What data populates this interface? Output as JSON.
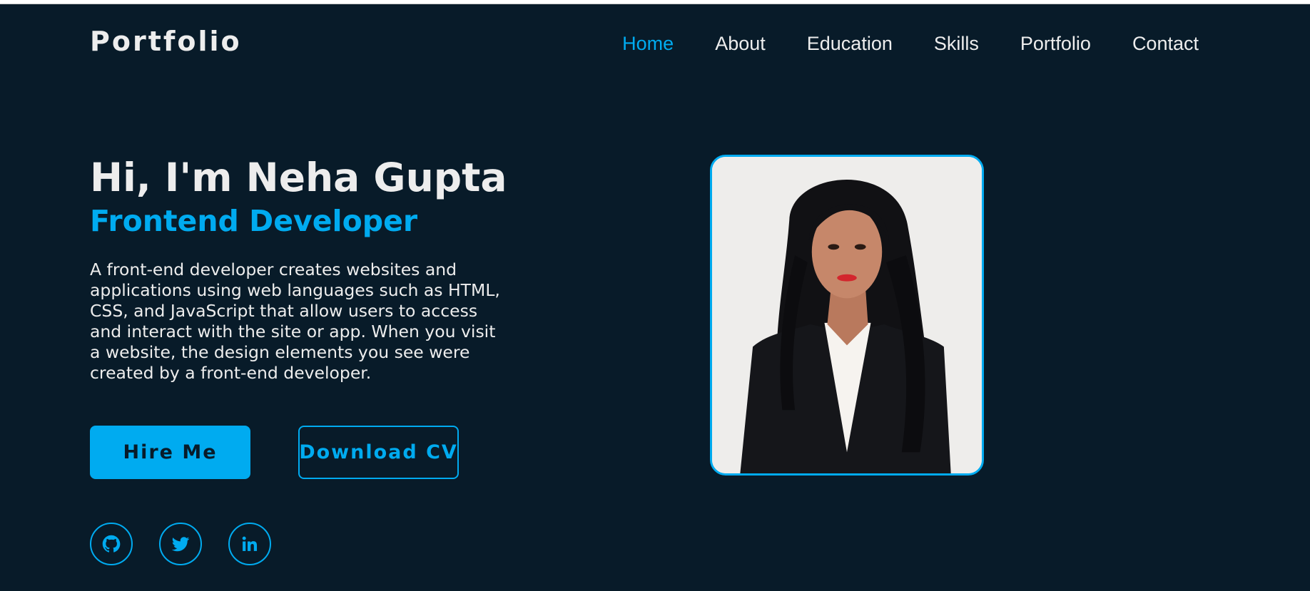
{
  "header": {
    "brand": "Portfolio",
    "nav": [
      {
        "label": "Home",
        "active": true
      },
      {
        "label": "About",
        "active": false
      },
      {
        "label": "Education",
        "active": false
      },
      {
        "label": "Skills",
        "active": false
      },
      {
        "label": "Portfolio",
        "active": false
      },
      {
        "label": "Contact",
        "active": false
      }
    ]
  },
  "hero": {
    "greeting": "Hi, I'm Neha Gupta",
    "role": "Frontend Developer",
    "bio": "A front-end developer creates websites and applications using web languages such as HTML, CSS, and JavaScript that allow users to access and interact with the site or app. When you visit a website, the design elements you see were created by a front-end developer.",
    "buttons": {
      "hire_label": "Hire Me",
      "cv_label": "Download CV"
    },
    "social": [
      {
        "icon": "github-icon"
      },
      {
        "icon": "twitter-icon"
      },
      {
        "icon": "linkedin-icon"
      }
    ],
    "photo": {
      "icon": "profile-photo"
    }
  },
  "colors": {
    "background": "#081b29",
    "accent": "#00abf0",
    "text": "#ededed"
  }
}
